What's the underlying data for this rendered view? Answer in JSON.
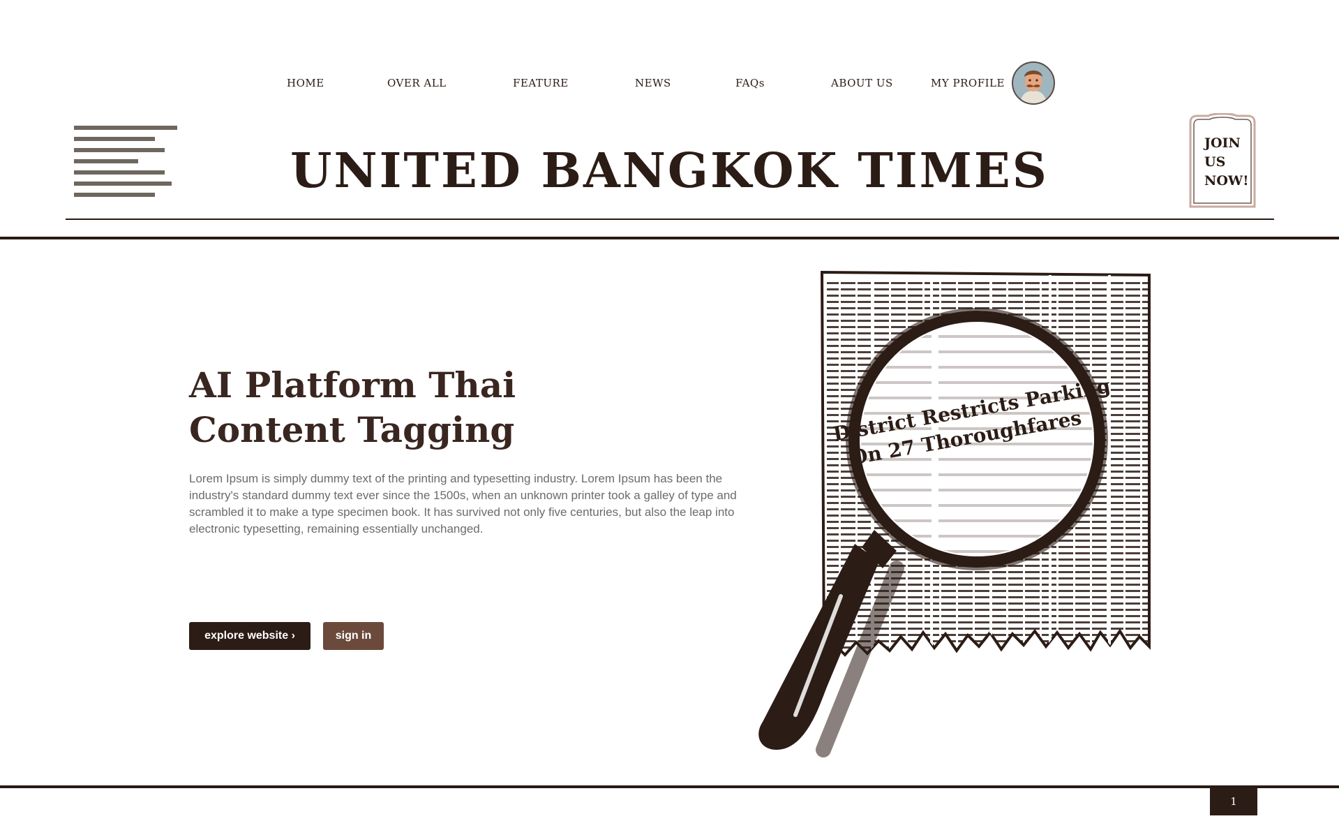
{
  "nav": {
    "home": "HOME",
    "over_all": "OVER ALL",
    "feature": "FEATURE",
    "news": "NEWS",
    "faqs": "FAQs",
    "about_us": "ABOUT US",
    "my_profile": "MY PROFILE"
  },
  "masthead": {
    "title": "UNITED BANGKOK TIMES",
    "join_line1": "JOIN",
    "join_line2": "US",
    "join_line3": "NOW!"
  },
  "hero": {
    "title": "AI Platform Thai Content Tagging",
    "body": "Lorem Ipsum is simply dummy text of the printing and typesetting industry. Lorem Ipsum has been the industry's standard dummy text ever since the 1500s, when an unknown printer took a galley of type and scrambled it to make a type specimen book. It has survived not only five centuries, but also the leap into electronic typesetting, remaining essentially unchanged.",
    "explore_label": "explore website ›",
    "signin_label": "sign in"
  },
  "illustration": {
    "headline_line1": "District Restricts Parking",
    "headline_line2": "On 27 Thoroughfares"
  },
  "pagination": {
    "current_page": "1"
  },
  "colors": {
    "ink": "#2c1c16",
    "brown_button": "#6b4a3c",
    "menu_bars": "#6e675f",
    "body_text": "#6e6a68",
    "join_frame": "#c8aba0"
  },
  "icons": {
    "menu": "hamburger-lines-icon",
    "profile": "avatar",
    "illustration": "magnifying-glass-newspaper"
  }
}
